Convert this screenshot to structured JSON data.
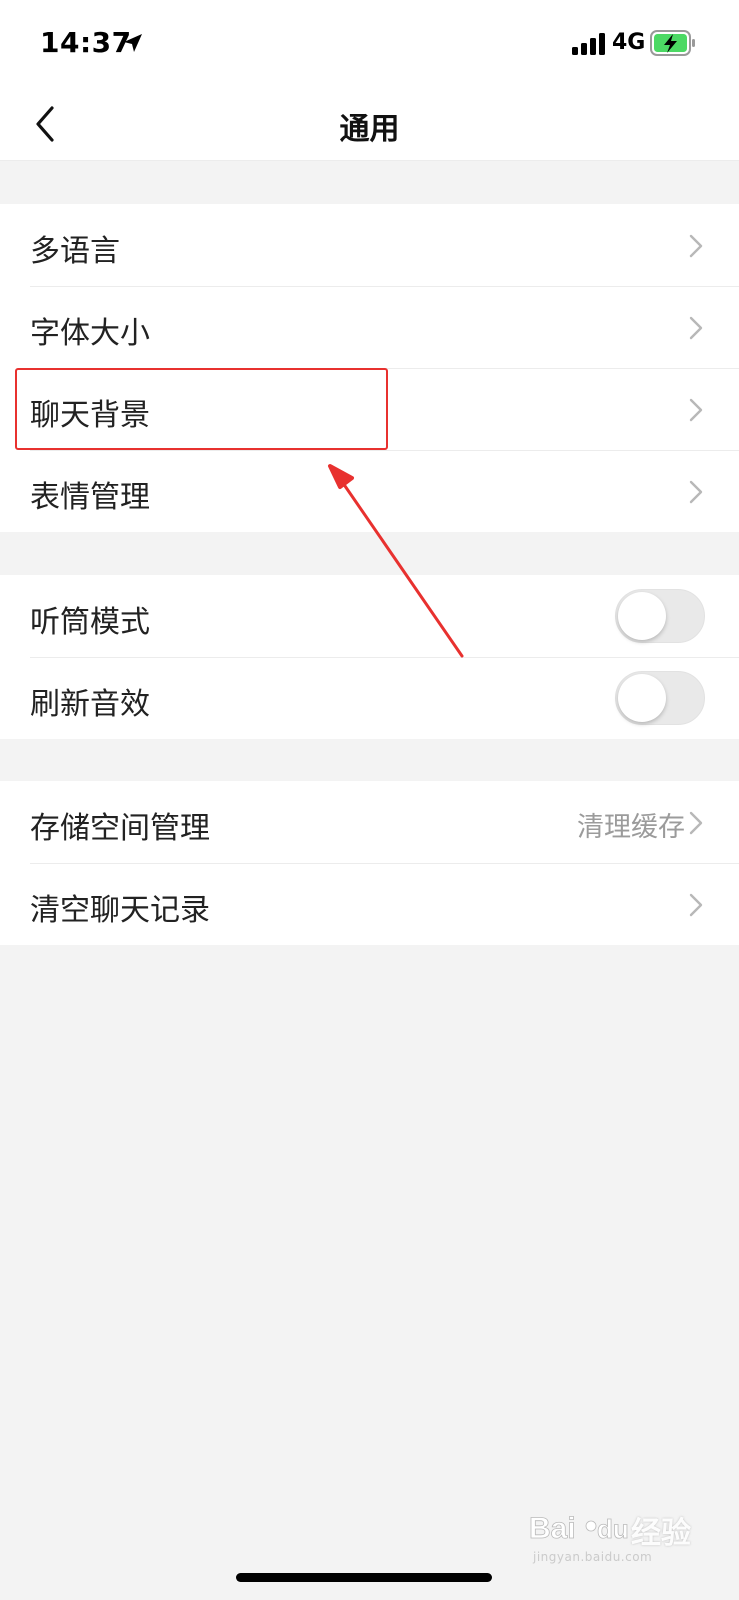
{
  "status_bar": {
    "time": "14:37",
    "network": "4G",
    "icons": [
      "location-arrow-icon",
      "signal-bars-icon",
      "battery-charging-icon"
    ]
  },
  "nav": {
    "title": "通用",
    "back_icon": "chevron-left-icon"
  },
  "groups": [
    {
      "rows": [
        {
          "label": "多语言",
          "type": "link"
        },
        {
          "label": "字体大小",
          "type": "link"
        },
        {
          "label": "聊天背景",
          "type": "link"
        },
        {
          "label": "表情管理",
          "type": "link"
        }
      ]
    },
    {
      "rows": [
        {
          "label": "听筒模式",
          "type": "toggle",
          "on": false
        },
        {
          "label": "刷新音效",
          "type": "toggle",
          "on": false
        }
      ]
    },
    {
      "rows": [
        {
          "label": "存储空间管理",
          "type": "link",
          "value": "清理缓存"
        },
        {
          "label": "清空聊天记录",
          "type": "link"
        }
      ]
    }
  ],
  "annotation": {
    "highlighted_row": "聊天背景",
    "color": "#e8312f"
  },
  "watermark": {
    "brand": "Bai",
    "brand_paw": "du",
    "product": "经验",
    "url": "jingyan.baidu.com"
  },
  "colors": {
    "background": "#f3f3f3",
    "row_background": "#ffffff",
    "label_text": "#222222",
    "secondary_text": "#9b9b9b",
    "annotation_red": "#e8312f",
    "battery_green": "#4cd964"
  }
}
